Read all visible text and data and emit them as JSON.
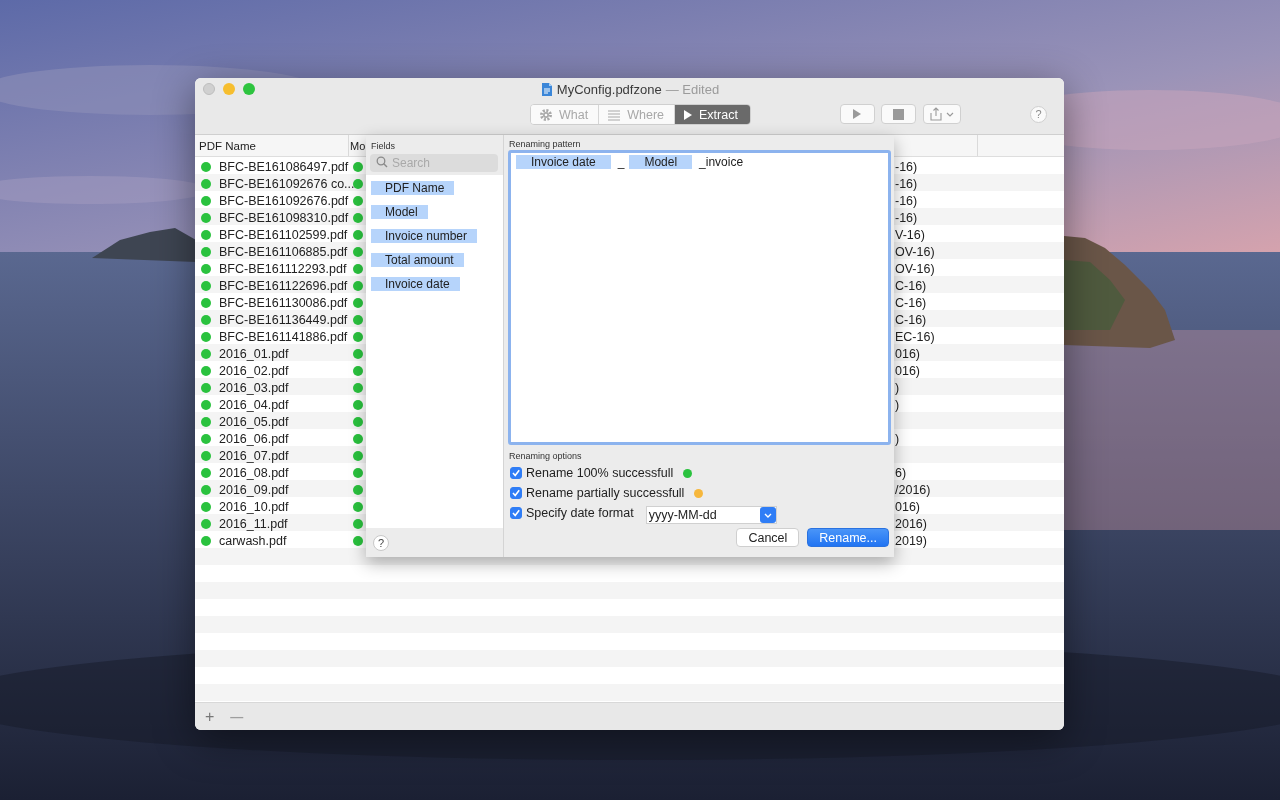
{
  "window": {
    "title": "MyConfig.pdfzone",
    "subtitle": "— Edited"
  },
  "toolbar": {
    "segments": [
      {
        "kind": "gear",
        "label": "What",
        "selected": false
      },
      {
        "kind": "lines",
        "label": "Where",
        "selected": false
      },
      {
        "kind": "play",
        "label": "Extract",
        "selected": true
      }
    ],
    "buttons": [
      {
        "kind": "play"
      },
      {
        "kind": "stop"
      },
      {
        "kind": "share"
      }
    ],
    "help": "?"
  },
  "table": {
    "columns": [
      "PDF Name",
      "Mo"
    ],
    "rows": [
      {
        "name": {
          "text": "BFC-BE161086497.pdf",
          "color": "#2ac23e"
        },
        "model": {
          "color": "#2ac23e"
        },
        "column_3": "-16)"
      },
      {
        "name": {
          "text": "BFC-BE161092676 co...",
          "color": "#2ac23e"
        },
        "model": {
          "color": "#2ac23e"
        },
        "column_3": "-16)"
      },
      {
        "name": {
          "text": "BFC-BE161092676.pdf",
          "color": "#2ac23e"
        },
        "model": {
          "color": "#2ac23e"
        },
        "column_3": "-16)"
      },
      {
        "name": {
          "text": "BFC-BE161098310.pdf",
          "color": "#2ac23e"
        },
        "model": {
          "color": "#2ac23e"
        },
        "column_3": "-16)"
      },
      {
        "name": {
          "text": "BFC-BE161102599.pdf",
          "color": "#2ac23e"
        },
        "model": {
          "color": "#2ac23e"
        },
        "column_3": "V-16)"
      },
      {
        "name": {
          "text": "BFC-BE161106885.pdf",
          "color": "#2ac23e"
        },
        "model": {
          "color": "#2ac23e"
        },
        "column_3": "OV-16)"
      },
      {
        "name": {
          "text": "BFC-BE161112293.pdf",
          "color": "#2ac23e"
        },
        "model": {
          "color": "#2ac23e"
        },
        "column_3": "OV-16)"
      },
      {
        "name": {
          "text": "BFC-BE161122696.pdf",
          "color": "#2ac23e"
        },
        "model": {
          "color": "#2ac23e"
        },
        "column_3": "C-16)"
      },
      {
        "name": {
          "text": "BFC-BE161130086.pdf",
          "color": "#2ac23e"
        },
        "model": {
          "color": "#2ac23e"
        },
        "column_3": "C-16)"
      },
      {
        "name": {
          "text": "BFC-BE161136449.pdf",
          "color": "#2ac23e"
        },
        "model": {
          "color": "#2ac23e"
        },
        "column_3": "C-16)"
      },
      {
        "name": {
          "text": "BFC-BE161141886.pdf",
          "color": "#2ac23e"
        },
        "model": {
          "color": "#2ac23e"
        },
        "column_3": "EC-16)"
      },
      {
        "name": {
          "text": "2016_01.pdf",
          "color": "#2ac23e"
        },
        "model": {
          "color": "#2ac23e"
        },
        "column_3": "016)"
      },
      {
        "name": {
          "text": "2016_02.pdf",
          "color": "#2ac23e"
        },
        "model": {
          "color": "#2ac23e"
        },
        "column_3": "016)"
      },
      {
        "name": {
          "text": "2016_03.pdf",
          "color": "#2ac23e"
        },
        "model": {
          "color": "#2ac23e"
        },
        "column_3": ")"
      },
      {
        "name": {
          "text": "2016_04.pdf",
          "color": "#2ac23e"
        },
        "model": {
          "color": "#2ac23e"
        },
        "column_3": ")"
      },
      {
        "name": {
          "text": "2016_05.pdf",
          "color": "#2ac23e"
        },
        "model": {
          "color": "#2ac23e"
        }
      },
      {
        "name": {
          "text": "2016_06.pdf",
          "color": "#2ac23e"
        },
        "model": {
          "color": "#2ac23e"
        },
        "column_3": ")"
      },
      {
        "name": {
          "text": "2016_07.pdf",
          "color": "#2ac23e"
        },
        "model": {
          "color": "#2ac23e"
        }
      },
      {
        "name": {
          "text": "2016_08.pdf",
          "color": "#2ac23e"
        },
        "model": {
          "color": "#2ac23e"
        },
        "column_3": "6)"
      },
      {
        "name": {
          "text": "2016_09.pdf",
          "color": "#2ac23e"
        },
        "model": {
          "color": "#2ac23e"
        },
        "column_3": "/2016)"
      },
      {
        "name": {
          "text": "2016_10.pdf",
          "color": "#2ac23e"
        },
        "model": {
          "color": "#2ac23e"
        },
        "column_3": "016)"
      },
      {
        "name": {
          "text": "2016_11.pdf",
          "color": "#2ac23e"
        },
        "model": {
          "color": "#2ac23e"
        },
        "column_3": "2016)"
      },
      {
        "name": {
          "text": "carwash.pdf",
          "color": "#2ac23e"
        },
        "model": {
          "color": "#2ac23e"
        },
        "column_3": "2019)"
      }
    ]
  },
  "bottom_bar": {
    "buttons": [
      {
        "text": "+",
        "disabled": false
      },
      {
        "text": "—",
        "disabled": true
      }
    ]
  },
  "sheet": {
    "fields": {
      "title": "Fields",
      "search": {
        "placeholder": "Search"
      },
      "items": [
        "PDF Name",
        "Model",
        "Invoice number",
        "Total amount",
        "Invoice date"
      ]
    },
    "help": "?",
    "pattern": {
      "title": "Renaming pattern",
      "tokens": [
        {
          "kind": "field",
          "text": "Invoice date"
        },
        {
          "kind": "text",
          "text": "_"
        },
        {
          "kind": "field",
          "text": "Model"
        },
        {
          "kind": "text",
          "text": "_invoice"
        }
      ]
    },
    "options": {
      "title": "Renaming options",
      "items": [
        {
          "label": "Rename 100% successfull",
          "checked": true,
          "color": "#2ac23e"
        },
        {
          "label": "Rename partially successfull",
          "checked": true,
          "color": "#f6b73c"
        },
        {
          "label": "Specify date format",
          "checked": true
        }
      ],
      "date_format": {
        "value": "yyyy-MM-dd"
      }
    },
    "buttons": [
      {
        "label": "Cancel",
        "default": false
      },
      {
        "label": "Rename...",
        "default": true
      }
    ]
  }
}
